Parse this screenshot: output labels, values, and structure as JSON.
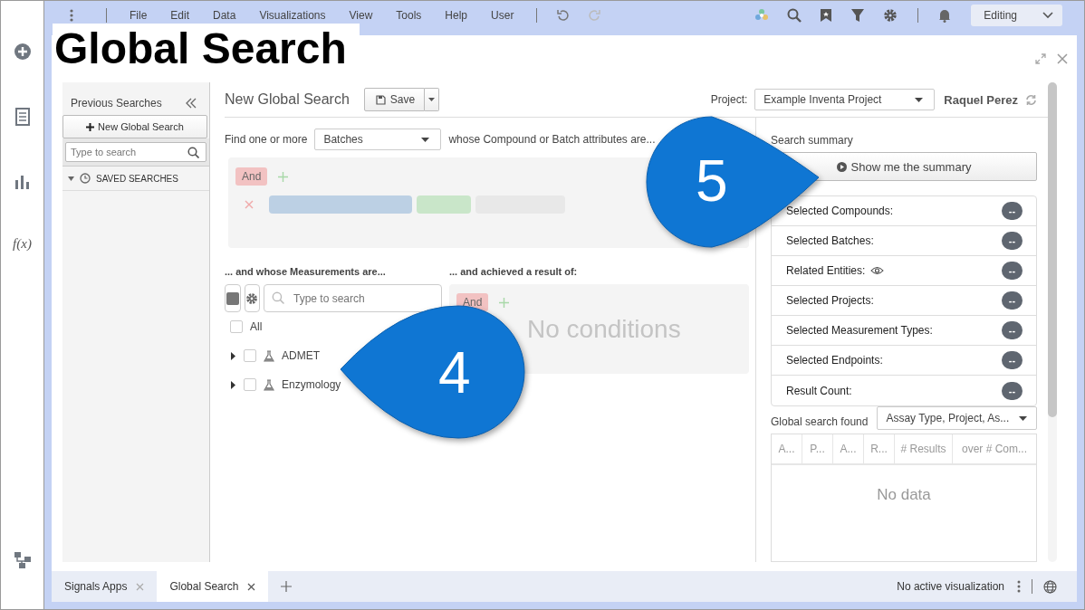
{
  "rail": {
    "formula": "f(x)"
  },
  "menu_bar": {
    "items": [
      "File",
      "Edit",
      "Data",
      "Visualizations",
      "View",
      "Tools",
      "Help",
      "User"
    ],
    "mode": "Editing"
  },
  "overlay_title": "Global Search",
  "previous_searches": {
    "title": "Previous Searches",
    "new_button": "New Global Search",
    "search_placeholder": "Type to search",
    "tree": [
      {
        "label": "SAVED SEARCHES",
        "expanded": true
      }
    ]
  },
  "search": {
    "title": "New Global Search",
    "save_button": "Save",
    "project_label": "Project:",
    "project": "Example Inventa Project",
    "user": "Raquel Perez",
    "find_label": "Find one or more",
    "entity": "Batches",
    "attributes_label": "whose Compound or Batch attributes are...",
    "operator": "And",
    "measurements_label": "... and whose Measurements are...",
    "measure_search_placeholder": "Type to search",
    "all": {
      "label": "All",
      "checked": false
    },
    "measurements": [
      {
        "label": "ADMET",
        "checked": false,
        "expanded": false
      },
      {
        "label": "Enzymology",
        "checked": false,
        "expanded": false
      }
    ],
    "result_label": "... and achieved a result of:",
    "result_operator": "And",
    "result_empty": "No conditions"
  },
  "summary": {
    "title": "Search summary",
    "button": "Show me the summary",
    "rows": [
      {
        "label": "Selected Compounds:",
        "value": "--",
        "eye": false
      },
      {
        "label": "Selected Batches:",
        "value": "--",
        "eye": false
      },
      {
        "label": "Related Entities:",
        "value": "--",
        "eye": true
      },
      {
        "label": "Selected Projects:",
        "value": "--",
        "eye": false
      },
      {
        "label": "Selected Measurement Types:",
        "value": "--",
        "eye": false
      },
      {
        "label": "Selected Endpoints:",
        "value": "--",
        "eye": false
      },
      {
        "label": "Result Count:",
        "value": "--",
        "eye": false
      }
    ],
    "found_label": "Global search found",
    "grouping": "Assay Type, Project, As...",
    "columns": [
      "A...",
      "P...",
      "A...",
      "R...",
      "# Results",
      "over # Com..."
    ],
    "empty": "No data"
  },
  "tabs": [
    {
      "label": "Signals Apps",
      "selected": false
    },
    {
      "label": "Global Search",
      "selected": true
    }
  ],
  "status": "No active visualization",
  "callouts": [
    {
      "label": "4",
      "kind": "left"
    },
    {
      "label": "5",
      "kind": "right"
    }
  ]
}
